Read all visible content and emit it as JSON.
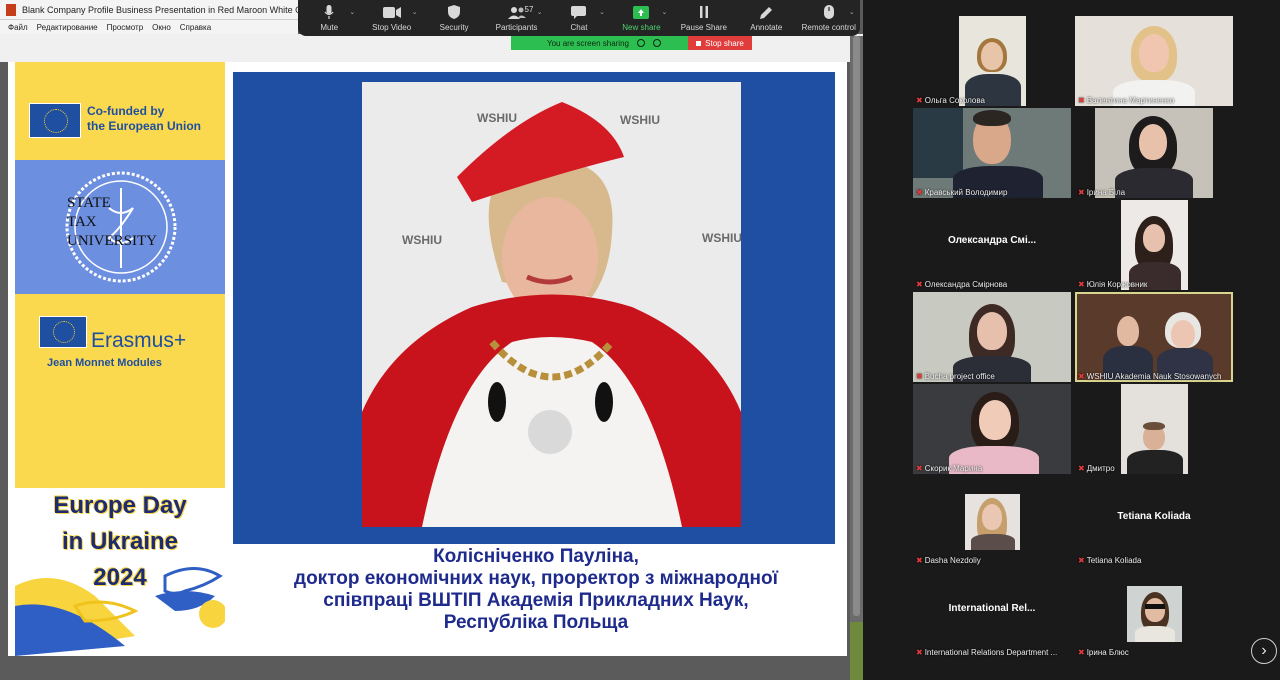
{
  "powerpoint": {
    "window_title": "Blank Company Profile Business Presentation in Red Maroon White Geometric",
    "menu": [
      "Файл",
      "Редактирование",
      "Просмотр",
      "Окно",
      "Справка"
    ]
  },
  "zoom_toolbar": {
    "mute": "Mute",
    "stop_video": "Stop Video",
    "security": "Security",
    "participants": "Participants",
    "participants_count": "57",
    "chat": "Chat",
    "new_share": "New share",
    "pause_share": "Pause Share",
    "annotate": "Annotate",
    "remote_control": "Remote control"
  },
  "share_banner": {
    "status": "You are screen sharing",
    "stop": "Stop share"
  },
  "slide": {
    "eu_line1": "Co-funded by",
    "eu_line2": "the European Union",
    "univ_line1": "STATE",
    "univ_line2": "TAX",
    "univ_line3": "UNIVERSITY",
    "erasmus": "Erasmus+",
    "jean_monnet": "Jean Monnet Modules",
    "europe_line1": "Europe Day",
    "europe_line2": "in Ukraine",
    "europe_line3": "2024",
    "backdrop_logo": "WSHIU",
    "caption_line1": "Колісніченко Пауліна,",
    "caption_line2": "доктор економічних наук, проректор з міжнародної",
    "caption_line3": "співпраці ВШТІП Академія Прикладних Наук,",
    "caption_line4": "Республіка Польща"
  },
  "participants": [
    {
      "name": "Ольга Соколова",
      "video": true
    },
    {
      "name": "Валентина Мартиненко",
      "video": true
    },
    {
      "name": "Кравський Володимир",
      "video": true
    },
    {
      "name": "Ірина Біла",
      "video": true
    },
    {
      "name": "Олександра Смірнова",
      "video": false,
      "display": "Олександра  Смі..."
    },
    {
      "name": "Юлія Коржовник",
      "video": true
    },
    {
      "name": "Bucha project office",
      "video": true
    },
    {
      "name": "WSHIU Akademia Nauk Stosowanych",
      "video": true,
      "active": true
    },
    {
      "name": "Скорик Марина",
      "video": true
    },
    {
      "name": "Дмитро",
      "video": true
    },
    {
      "name": "Dasha Nezdoliy",
      "video": true
    },
    {
      "name": "Tetiana Koliada",
      "video": false,
      "display": "Tetiana Koliada"
    },
    {
      "name": "International Relations Department ...",
      "video": false,
      "display": "International  Rel..."
    },
    {
      "name": "Ірина Блюс",
      "video": true
    }
  ],
  "colors": {
    "slide_blue": "#1e4fa3",
    "slide_yellow": "#fad94e",
    "caption_navy": "#1e2b8c",
    "share_green": "#2dbe52",
    "stop_red": "#e03c3c",
    "active_speaker": "#d9d58e"
  },
  "icons": {
    "next_page": "chevron-right-icon",
    "muted": "mic-off-icon"
  }
}
